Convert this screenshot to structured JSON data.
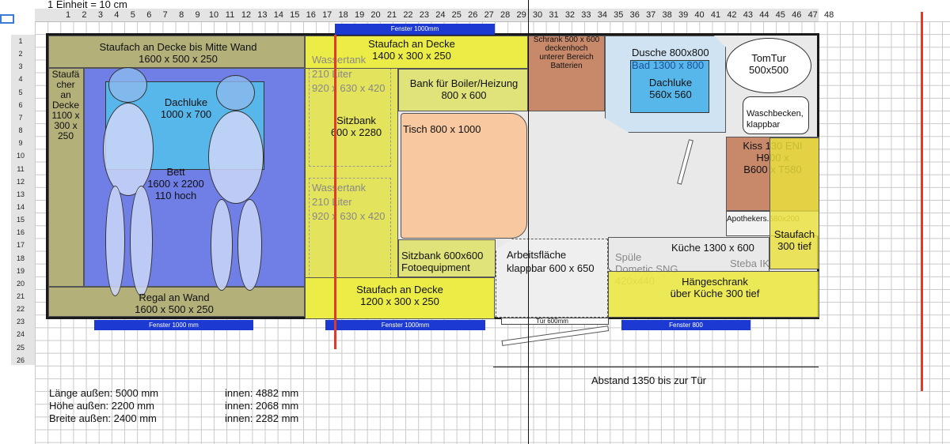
{
  "scale_note": "1 Einheit = 10 cm",
  "columns": [
    "1",
    "2",
    "3",
    "4",
    "5",
    "6",
    "7",
    "8",
    "9",
    "10",
    "11",
    "12",
    "13",
    "14",
    "15",
    "16",
    "17",
    "18",
    "19",
    "20",
    "21",
    "22",
    "23",
    "24",
    "25",
    "26",
    "27",
    "28",
    "29",
    "30",
    "31",
    "32",
    "33",
    "34",
    "35",
    "36",
    "37",
    "38",
    "39",
    "40",
    "41",
    "42",
    "43",
    "44",
    "45",
    "46",
    "47",
    "48"
  ],
  "rows": [
    "1",
    "2",
    "3",
    "4",
    "5",
    "6",
    "7",
    "8",
    "9",
    "10",
    "11",
    "12",
    "13",
    "14",
    "15",
    "16",
    "17",
    "18",
    "19",
    "20",
    "21",
    "22",
    "23",
    "24",
    "25",
    "26"
  ],
  "windows": {
    "top": "Fenster 1000mm",
    "bottom_left": "Fenster 1000 mm",
    "bottom_mid": "Fenster 1000mm",
    "bottom_right": "Fenster 800"
  },
  "zones": {
    "staufach_decke_wand": [
      "Staufach an Decke bis Mitte Wand",
      "1600 x 500 x 250"
    ],
    "staufach_links": [
      "Staufä",
      "cher",
      "an",
      "Decke",
      "1100 x",
      "300 x",
      "250"
    ],
    "dachluke_links": [
      "Dachluke",
      "1000 x 700"
    ],
    "bett": [
      "Bett",
      "1600 x 2200",
      "110 hoch"
    ],
    "regal": [
      "Regal an Wand",
      "1600 x 500 x 250"
    ],
    "wassertank_oben": [
      "Wassertank",
      "210 Liter",
      "920 x 630 x 420"
    ],
    "wassertank_unten": [
      "Wassertank",
      "210 Liter",
      "920 x 630 x 420"
    ],
    "sitzbank": [
      "Sitzbank",
      "600 x 2280"
    ],
    "staufach_decke_oben": [
      "Staufach an Decke",
      "1400 x 300 x 250"
    ],
    "bank_boiler": [
      "Bank für Boiler/Heizung",
      "800 x 600"
    ],
    "tisch": "Tisch 800 x 1000",
    "sitzbank_foto": [
      "Sitzbank 600x600",
      "Fotoequipment"
    ],
    "staufach_decke_unten": [
      "Staufach an Decke",
      "1200 x 300 x 250"
    ],
    "schrank": [
      "Schrank 500 x 600",
      "deckenhoch",
      "unterer Bereich",
      "Batterien"
    ],
    "dusche": "Dusche 800x800",
    "bad": "Bad 1300 x 800",
    "dachluke_bad": [
      "Dachluke",
      "560x 560"
    ],
    "tomtur": [
      "TomTur",
      "500x500"
    ],
    "waschbecken": [
      "Waschbecken,",
      "klappbar"
    ],
    "kiss": [
      "Kiss 130 ENI",
      "H900 x",
      "B600 x T580"
    ],
    "apotheker": "Apothekers.",
    "apotheker_size": "580x200",
    "staufach_tief": [
      "Staufach",
      "300 tief"
    ],
    "kueche": "Küche 1300 x 600",
    "steba": "Steba IK",
    "spuele": [
      "Spüle",
      "Dometic SNG",
      "420x440"
    ],
    "haengeschrank": [
      "Hängeschrank",
      "über Küche 300 tief"
    ],
    "arbeitsflaeche": [
      "Arbeitsfläche",
      "klappbar 600 x 650"
    ],
    "tuer": "Tür 600mm",
    "abstand": "Abstand 1350 bis zur Tür"
  },
  "dimensions": {
    "laenge": "Länge außen: 5000 mm",
    "hoehe": "Höhe außen: 2200 mm",
    "breite": "Breite außen: 2400 mm",
    "innen_laenge": "innen: 4882 mm",
    "innen_hoehe": "innen: 2068 mm",
    "innen_breite": "innen: 2282 mm"
  },
  "colors": {
    "bed_blue": "#6f7fe6",
    "skylight": "#58b7ea",
    "olive": "#b3b07a",
    "yellow": "#ecec46",
    "table": "#f8c9a0",
    "brown": "#c8896b",
    "bath": "#cfe3f3",
    "window": "#1c3ad1",
    "red_line": "#e23a2a"
  }
}
